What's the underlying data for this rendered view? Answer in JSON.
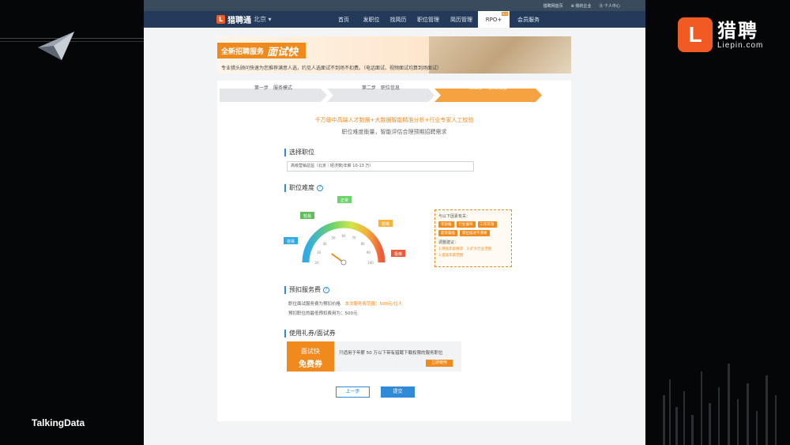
{
  "colors": {
    "accent": "#f08a1d",
    "navy": "#233a5b",
    "link": "#2f8ad8"
  },
  "slide": {
    "talkingdata": "TalkingData",
    "liepin_cn": "猎聘",
    "liepin_en": "Liepin.com",
    "liepin_icon": "L"
  },
  "topbar": {
    "items": [
      "猎聘网首页",
      "⊕ 我的企业",
      "⓪ 个人中心"
    ]
  },
  "nav": {
    "logo_icon": "L",
    "brand": "猎聘通",
    "city": "北京 ▾",
    "items": [
      {
        "label": "首页",
        "active": false
      },
      {
        "label": "发职位",
        "active": false
      },
      {
        "label": "找简历",
        "active": false
      },
      {
        "label": "职位管理",
        "active": false
      },
      {
        "label": "简历管理",
        "active": false
      },
      {
        "label": "RPO+",
        "active": true
      },
      {
        "label": "会员服务",
        "active": false
      }
    ],
    "badge": "hot"
  },
  "banner": {
    "prefix": "全新招聘服务",
    "title": "面试快",
    "desc": "专业猎头顾问快速为您推荐满意人选，约见人选面试不到场不扣费。（电话面试、视频面试均算到场面试）"
  },
  "steps": [
    "第一步　服务模式",
    "第二步　职位信息",
    "第三步　职位难度"
  ],
  "slogans": {
    "line1": "千万级中高端人才数据+大数据智能精准分析+行业专家人工校验",
    "line2": "职位难度衡量，智能评估合理预期招聘需求"
  },
  "sections": {
    "position": "选择职位",
    "difficulty": "职位难度",
    "fee": "预扣服务费",
    "coupon": "使用礼券/面试券"
  },
  "position_value": "高级营销总监（北京｜经济数|年薪 10-13 万）",
  "gauge": {
    "labels": [
      "容易",
      "较易",
      "正常",
      "较难",
      "极难"
    ],
    "ticks": [
      "20",
      "30",
      "40",
      "50",
      "60",
      "70",
      "80",
      "90",
      "100"
    ],
    "value_percent": 30
  },
  "tips": {
    "title": "与以下因素有关：",
    "tags": [
      "年龄偏",
      "行业偏窄",
      "工作年限",
      "薪资偏低",
      "职位描述不清晰"
    ],
    "advice_title": "调整建议：",
    "advice": [
      "1.降低年龄要求",
      "2.扩大行业范围",
      "3.提高年薪范围"
    ]
  },
  "fee": {
    "line1_label": "职位面试服务费为预扣价格",
    "line1_value": "本次服务费范围：500元/位人",
    "line2": "预扣职位的最低预扣费用为：500元"
  },
  "coupon": {
    "a": "面试快",
    "b": "免费券",
    "text": "只适用于年薪 50 万以下带有猎聘下载权限的服务职位",
    "use": "立即使用"
  },
  "buttons": {
    "prev": "上一步",
    "submit": "提交"
  }
}
